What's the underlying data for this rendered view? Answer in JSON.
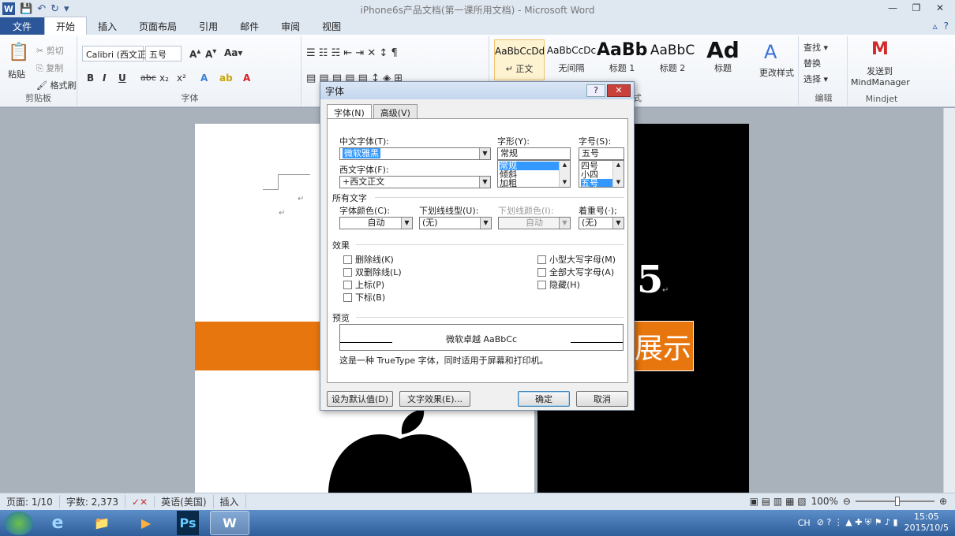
{
  "window": {
    "title": "iPhone6s产品文档(第一课所用文档) - Microsoft Word",
    "controls": [
      "—",
      "❐",
      "✕"
    ]
  },
  "qat": {
    "word_logo": "W",
    "save": "💾",
    "undo": "↶",
    "redo": "↻",
    "customize": "▾"
  },
  "tabs": [
    {
      "label": "文件"
    },
    {
      "label": "开始"
    },
    {
      "label": "插入"
    },
    {
      "label": "页面布局"
    },
    {
      "label": "引用"
    },
    {
      "label": "邮件"
    },
    {
      "label": "审阅"
    },
    {
      "label": "视图"
    }
  ],
  "ribbon": {
    "clipboard": {
      "paste": "粘贴",
      "cut": "剪切",
      "copy": "复制",
      "format_painter": "格式刷",
      "label": "剪贴板"
    },
    "font": {
      "font_name": "Calibri (西文正",
      "font_size": "五号",
      "label": "字体",
      "bold": "B",
      "italic": "I",
      "underline": "U",
      "strike": "abc",
      "sub": "x₂",
      "sup": "x²"
    },
    "styles": {
      "items": [
        {
          "sample": "AaBbCcDd",
          "name": "↵ 正文"
        },
        {
          "sample": "AaBbCcDc",
          "name": "无间隔"
        },
        {
          "sample": "AaBb",
          "name": "标题 1"
        },
        {
          "sample": "AaBbC",
          "name": "标题 2"
        },
        {
          "sample": "Ad",
          "name": "标题"
        }
      ],
      "change": "更改样式",
      "label": "式"
    },
    "editing": {
      "find": "查找 ▾",
      "replace": "替换",
      "select": "选择 ▾",
      "label": "编辑"
    },
    "mindjet": {
      "send": "发送到",
      "app": "MindManager",
      "label": "Mindjet"
    }
  },
  "document": {
    "big_text": "5",
    "orange_text": "展示"
  },
  "status": {
    "page": "页面: 1/10",
    "words": "字数: 2,373",
    "language": "英语(美国)",
    "mode": "插入",
    "zoom": "100%"
  },
  "taskbar": {
    "apps": [
      "e",
      "📁",
      "▶",
      "Ps",
      "W"
    ],
    "ime": "CH",
    "time": "15:05",
    "date": "2015/10/5"
  },
  "dialog": {
    "title": "字体",
    "help": "?",
    "close": "✕",
    "tabs": [
      "字体(N)",
      "高级(V)"
    ],
    "chinese_font_label": "中文字体(T):",
    "chinese_font_value": "微软雅黑",
    "western_font_label": "西文字体(F):",
    "western_font_value": "+西文正文",
    "style_label": "字形(Y):",
    "style_value": "常规",
    "style_options": [
      "常规",
      "倾斜",
      "加粗"
    ],
    "size_label": "字号(S):",
    "size_value": "五号",
    "size_options": [
      "四号",
      "小四",
      "五号"
    ],
    "all_text_label": "所有文字",
    "font_color_label": "字体颜色(C):",
    "font_color_value": "自动",
    "underline_type_label": "下划线线型(U):",
    "underline_type_value": "(无)",
    "underline_color_label": "下划线颜色(I):",
    "underline_color_value": "自动",
    "emphasis_label": "着重号(·);",
    "emphasis_value": "(无)",
    "effects_label": "效果",
    "effects_left": [
      "删除线(K)",
      "双删除线(L)",
      "上标(P)",
      "下标(B)"
    ],
    "effects_right": [
      "小型大写字母(M)",
      "全部大写字母(A)",
      "隐藏(H)"
    ],
    "preview_label": "预览",
    "preview_text": "微软卓越 AaBbCc",
    "info": "这是一种 TrueType 字体，同时适用于屏幕和打印机。",
    "buttons": {
      "default": "设为默认值(D)",
      "text_effects": "文字效果(E)...",
      "ok": "确定",
      "cancel": "取消"
    }
  }
}
